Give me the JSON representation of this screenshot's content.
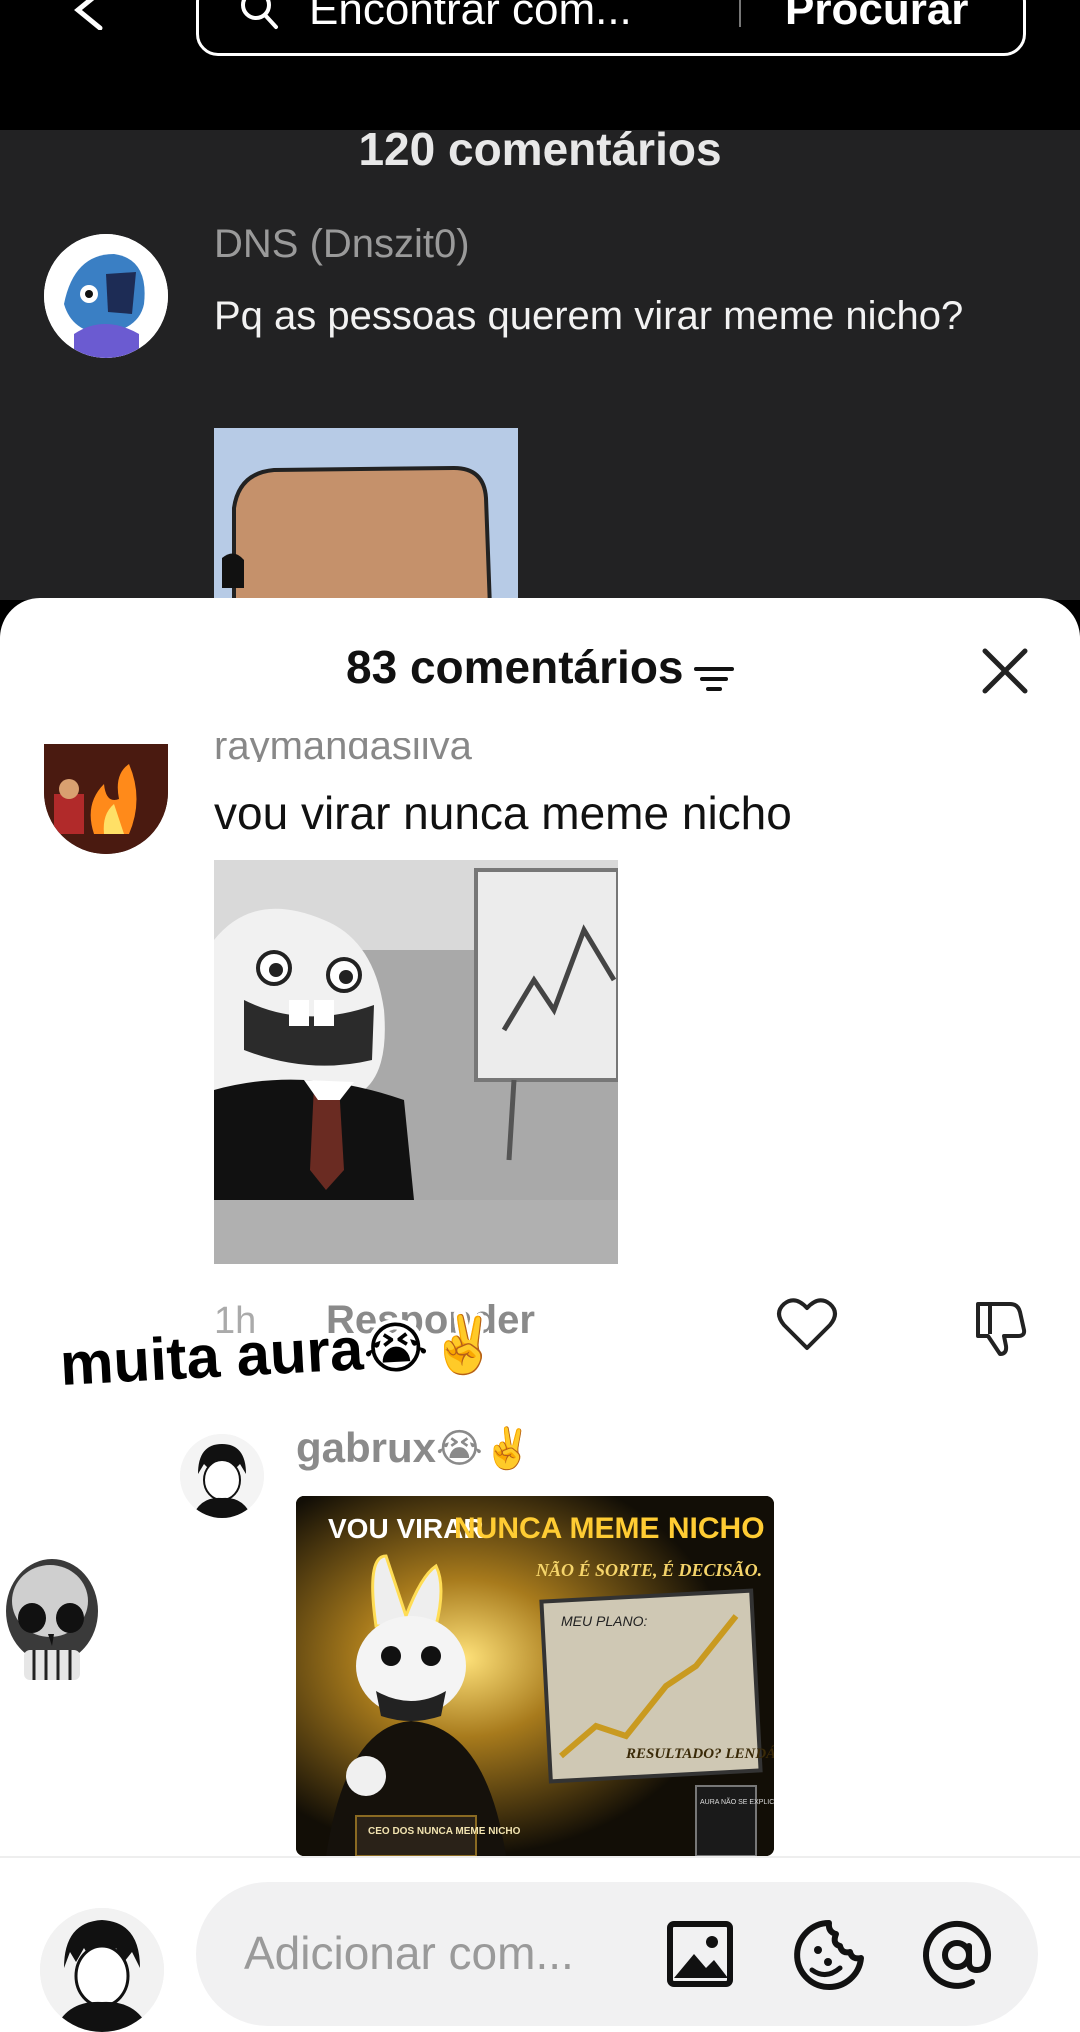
{
  "topbar": {
    "search_placeholder": "Encontrar com...",
    "search_button": "Procurar"
  },
  "background_comments": {
    "count_label": "120 comentários",
    "username": "DNS (Dnszit0)",
    "text": "Pq as pessoas querem virar meme nicho?"
  },
  "sheet": {
    "title": "83 comentários",
    "comment1": {
      "username": "raymandasilva",
      "text": "vou virar nunca meme nicho",
      "time": "1h",
      "reply_label": "Responder"
    },
    "overlay_caption": "muita aura",
    "overlay_emoji": "😭✌️",
    "comment2": {
      "username": "gabrux",
      "username_emoji": "😭✌️",
      "image_texts": {
        "headline_a": "VOU VIRAR",
        "headline_b": "NUNCA MEME NICHO",
        "sub": "NÃO É SORTE, É DECISÃO.",
        "plan_title": "MEU PLANO:",
        "result": "RESULTADO? LENDÁRIO.",
        "ceo": "CEO DOS NUNCA MEME NICHO",
        "mug": "AURA NÃO SE EXPLICA"
      }
    }
  },
  "input": {
    "placeholder": "Adicionar com..."
  },
  "colors": {
    "dark_bg": "#222223",
    "sheet_bg": "#ffffff",
    "input_bg": "#f1f1f2",
    "muted_text": "#8a8a8a"
  }
}
